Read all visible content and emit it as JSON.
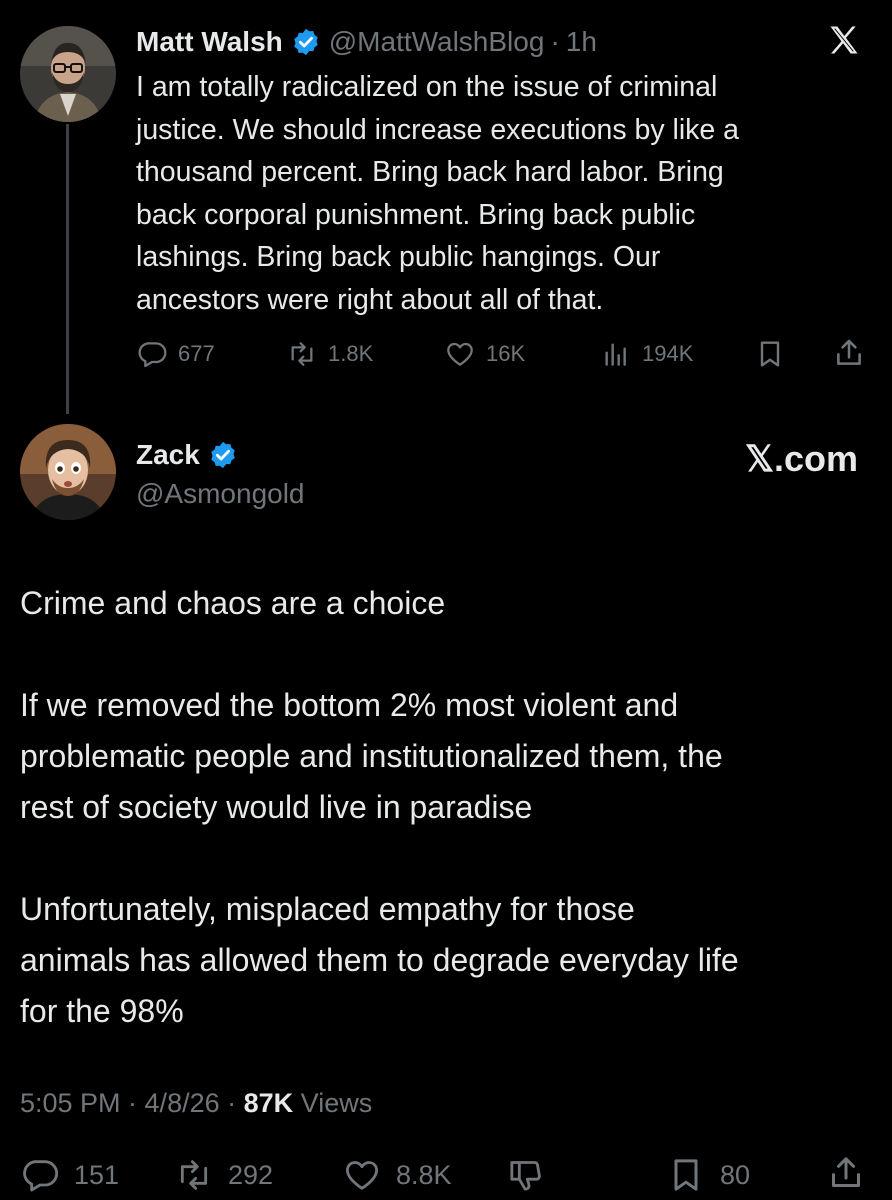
{
  "quoted_tweet": {
    "display_name": "Matt Walsh",
    "handle": "@MattWalshBlog",
    "separator": "·",
    "time": "1h",
    "text_lines": [
      "I am totally radicalized on the issue of criminal",
      "justice. We should increase executions by like a",
      "thousand percent. Bring back hard labor. Bring",
      "back corporal punishment. Bring back public",
      "lashings. Bring back public hangings. Our",
      "ancestors were right about all of that."
    ],
    "metrics": {
      "replies": "677",
      "reposts": "1.8K",
      "likes": "16K",
      "views": "194K"
    },
    "logo": "𝕏"
  },
  "main_tweet": {
    "display_name": "Zack",
    "handle": "@Asmongold",
    "site_logo": "𝕏.com",
    "paragraphs": [
      [
        "Crime and chaos are a choice"
      ],
      [
        "If we removed the bottom 2% most violent and",
        "problematic people and institutionalized them, the",
        "rest of society would live in paradise"
      ],
      [
        "Unfortunately, misplaced empathy for those",
        "animals has allowed them to degrade everyday life",
        "for the 98%"
      ]
    ],
    "timestamp": "5:05 PM · 4/8/26 ·",
    "views_count": "87K",
    "views_label": "Views",
    "metrics": {
      "replies": "151",
      "reposts": "292",
      "likes": "8.8K",
      "bookmarks": "80"
    }
  },
  "colors": {
    "background": "#000000",
    "text": "#e7e9ea",
    "secondary": "#71767b",
    "verified": "#1d9bf0"
  },
  "icons": [
    "reply-icon",
    "repost-icon",
    "like-icon",
    "views-icon",
    "bookmark-icon",
    "share-icon",
    "dislike-icon",
    "verified-badge-icon",
    "x-logo-icon"
  ]
}
